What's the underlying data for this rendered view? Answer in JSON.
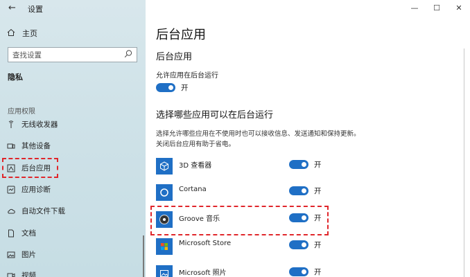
{
  "window": {
    "title": "设置",
    "back_glyph": "←",
    "minimize_glyph": "—",
    "maximize_glyph": "☐",
    "close_glyph": "✕"
  },
  "sidebar": {
    "home_label": "主页",
    "search_placeholder": "查找设置",
    "section_title": "隐私",
    "group_title": "应用权限",
    "items": [
      {
        "label": "无线收发器",
        "icon": "antenna-icon"
      },
      {
        "label": "其他设备",
        "icon": "devices-icon"
      },
      {
        "label": "后台应用",
        "icon": "background-apps-icon",
        "selected": true
      },
      {
        "label": "应用诊断",
        "icon": "diagnostics-icon"
      },
      {
        "label": "自动文件下载",
        "icon": "cloud-icon"
      },
      {
        "label": "文档",
        "icon": "document-icon"
      },
      {
        "label": "图片",
        "icon": "picture-icon"
      },
      {
        "label": "视频",
        "icon": "video-icon"
      }
    ]
  },
  "main": {
    "page_title": "后台应用",
    "section1_title": "后台应用",
    "allow_label": "允许应用在后台运行",
    "allow_state": "开",
    "section2_title": "选择哪些应用可以在后台运行",
    "description": "选择允许哪些应用在不使用时也可以接收信息、发送通知和保持更新。关闭后台应用有助于省电。",
    "apps": [
      {
        "name": "3D 查看器",
        "state": "开",
        "icon": "3d-viewer-icon"
      },
      {
        "name": "Cortana",
        "state": "开",
        "icon": "cortana-icon"
      },
      {
        "name": "Groove 音乐",
        "state": "开",
        "icon": "groove-music-icon"
      },
      {
        "name": "Microsoft Store",
        "state": "开",
        "icon": "store-icon"
      },
      {
        "name": "Microsoft 照片",
        "state": "开",
        "icon": "photos-icon"
      }
    ]
  },
  "colors": {
    "accent": "#1f6fc5",
    "highlight": "#e0262b"
  }
}
